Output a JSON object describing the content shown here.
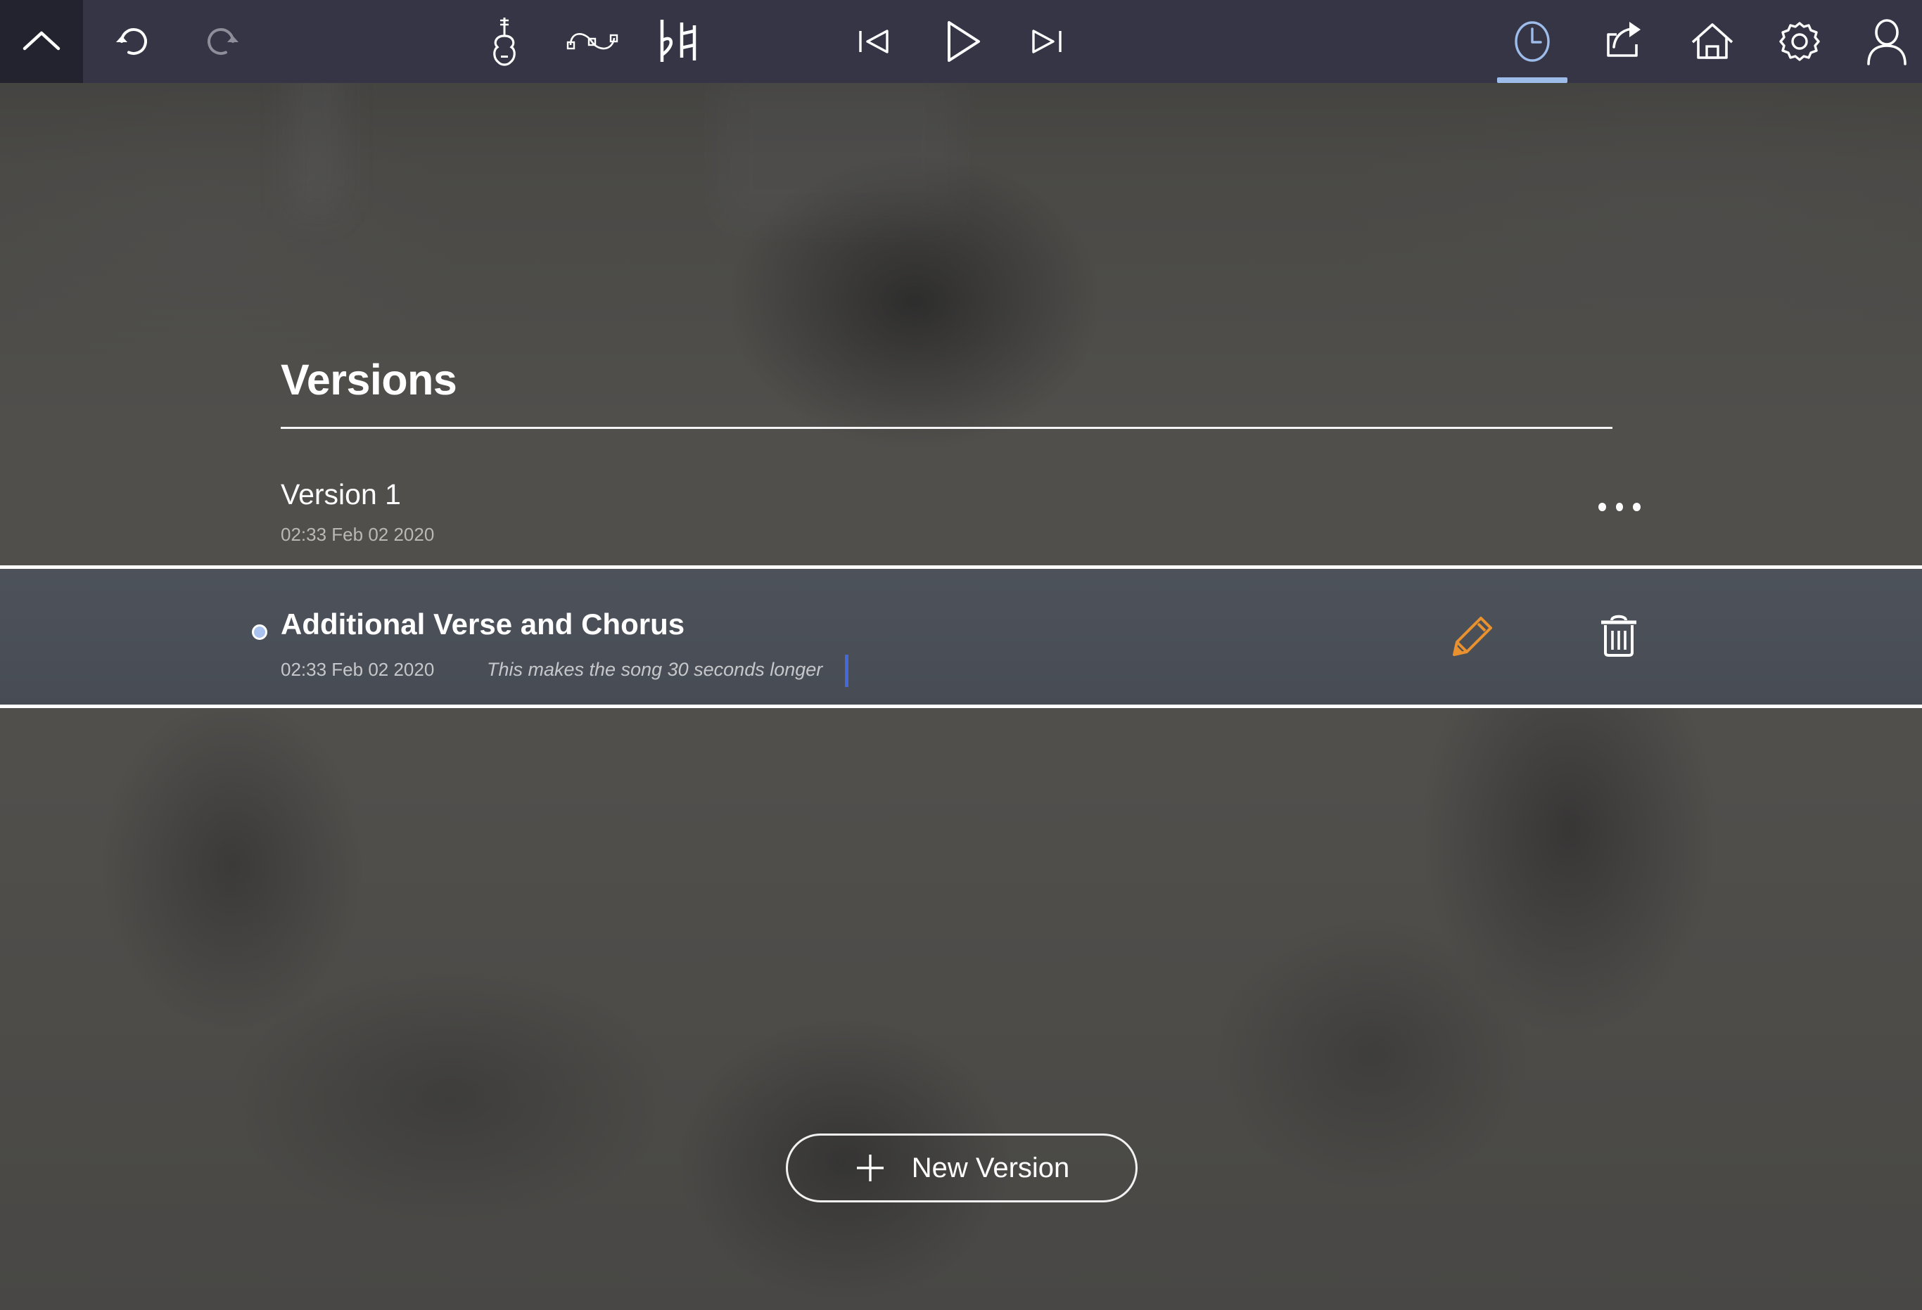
{
  "app": {
    "accent_blue": "#9dbcea",
    "accent_orange": "#e8912e",
    "toolbar_bg": "#363546",
    "selected_row_bg": "#4b5058",
    "caret_color": "#4668d8"
  },
  "toolbar": {
    "collapse": {
      "icon": "chevron-up-icon",
      "label": "Collapse"
    },
    "left_tools": [
      {
        "icon": "undo-icon",
        "label": "Undo",
        "enabled": true
      },
      {
        "icon": "redo-icon",
        "label": "Redo",
        "enabled": false
      }
    ],
    "center_tools": [
      {
        "icon": "instrument-icon",
        "label": "Instrument"
      },
      {
        "icon": "automation-curve-icon",
        "label": "Automation"
      },
      {
        "icon": "accidentals-icon",
        "label": "Accidentals"
      }
    ],
    "transport": [
      {
        "icon": "skip-back-icon",
        "label": "Skip to start"
      },
      {
        "icon": "play-icon",
        "label": "Play"
      },
      {
        "icon": "skip-forward-icon",
        "label": "Skip to end"
      }
    ],
    "right_tools": [
      {
        "icon": "history-clock-icon",
        "label": "Versions",
        "active": true
      },
      {
        "icon": "share-icon",
        "label": "Share",
        "active": false
      },
      {
        "icon": "home-icon",
        "label": "Home",
        "active": false
      },
      {
        "icon": "gear-icon",
        "label": "Settings",
        "active": false
      },
      {
        "icon": "user-icon",
        "label": "Account",
        "active": false
      }
    ]
  },
  "versions_panel": {
    "title": "Versions",
    "rows": [
      {
        "name": "Version 1",
        "timestamp": "02:33 Feb 02 2020",
        "note": "",
        "selected": false,
        "menu_icon": "overflow-dots-icon"
      },
      {
        "name": "Additional Verse and Chorus",
        "timestamp": "02:33 Feb 02 2020",
        "note": "This makes the song 30 seconds longer",
        "selected": true,
        "edit_icon": "pencil-icon",
        "delete_icon": "trash-icon"
      }
    ],
    "new_version_button": {
      "label": "New Version",
      "icon": "plus-icon"
    }
  }
}
